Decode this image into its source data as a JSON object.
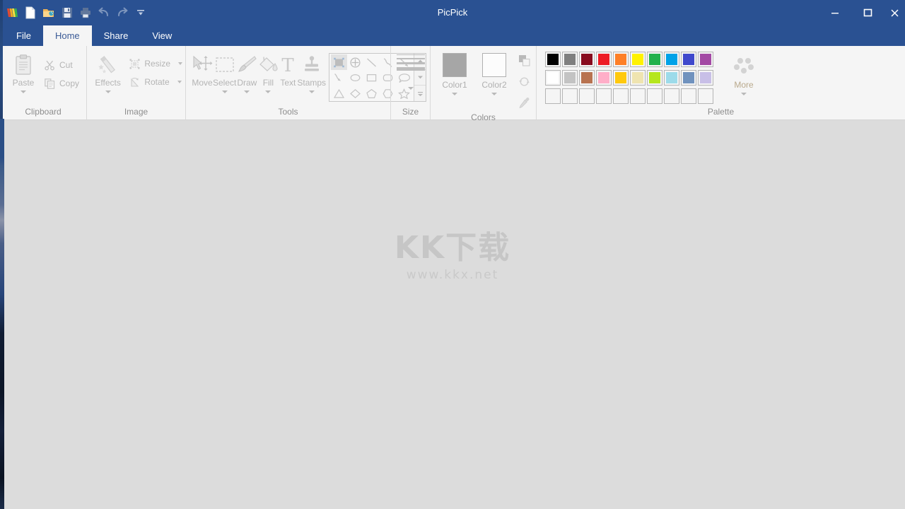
{
  "window": {
    "title": "PicPick",
    "minimize_label": "Minimize",
    "restore_label": "Restore",
    "close_label": "Close"
  },
  "quick_access": {
    "items": [
      {
        "name": "app-logo-icon",
        "label": "PicPick"
      },
      {
        "name": "new-icon",
        "label": "New"
      },
      {
        "name": "open-icon",
        "label": "Open"
      },
      {
        "name": "save-icon",
        "label": "Save"
      },
      {
        "name": "print-icon",
        "label": "Print"
      },
      {
        "name": "undo-icon",
        "label": "Undo"
      },
      {
        "name": "redo-icon",
        "label": "Redo"
      },
      {
        "name": "customize-icon",
        "label": "Customize Quick Access Toolbar"
      }
    ]
  },
  "tabs": [
    {
      "label": "File",
      "active": false
    },
    {
      "label": "Home",
      "active": true
    },
    {
      "label": "Share",
      "active": false
    },
    {
      "label": "View",
      "active": false
    }
  ],
  "ribbon": {
    "clipboard": {
      "label": "Clipboard",
      "paste": "Paste",
      "cut": "Cut",
      "copy": "Copy"
    },
    "image": {
      "label": "Image",
      "effects": "Effects",
      "resize": "Resize",
      "rotate": "Rotate"
    },
    "tools": {
      "label": "Tools",
      "buttons": [
        {
          "label": "Move",
          "has_caret": false
        },
        {
          "label": "Select",
          "has_caret": true
        },
        {
          "label": "Draw",
          "has_caret": true
        },
        {
          "label": "Fill",
          "has_caret": true
        },
        {
          "label": "Text",
          "has_caret": false
        },
        {
          "label": "Stamps",
          "has_caret": true
        }
      ],
      "shapes": [
        {
          "name": "shape-rectangle-filled",
          "selected": true
        },
        {
          "name": "shape-target-circle",
          "selected": false
        },
        {
          "name": "shape-line",
          "selected": false
        },
        {
          "name": "shape-curve",
          "selected": false
        },
        {
          "name": "shape-arrow",
          "selected": false
        },
        {
          "name": "shape-curved-arrow",
          "selected": false
        },
        {
          "name": "shape-ellipse",
          "selected": false
        },
        {
          "name": "shape-rectangle",
          "selected": false
        },
        {
          "name": "shape-rounded-rectangle",
          "selected": false
        },
        {
          "name": "shape-speech-balloon",
          "selected": false
        },
        {
          "name": "shape-triangle",
          "selected": false
        },
        {
          "name": "shape-diamond",
          "selected": false
        },
        {
          "name": "shape-pentagon",
          "selected": false
        },
        {
          "name": "shape-hexagon",
          "selected": false
        },
        {
          "name": "shape-star",
          "selected": false
        }
      ],
      "gallery_scroll": [
        {
          "name": "gallery-scroll-up",
          "label": "Scroll up"
        },
        {
          "name": "gallery-scroll-down",
          "label": "Scroll down"
        },
        {
          "name": "gallery-expand",
          "label": "More shapes"
        }
      ]
    },
    "size": {
      "label": "Size",
      "line_widths": [
        1,
        2,
        3,
        5
      ]
    },
    "colors": {
      "label": "Colors",
      "color1_label": "Color1",
      "color1_value": "#a6a6a6",
      "color2_label": "Color2",
      "color2_value": "#fcfcfc",
      "tools": [
        {
          "name": "color-swap-icon",
          "label": "Swap colors"
        },
        {
          "name": "color-reset-icon",
          "label": "Reset colors"
        },
        {
          "name": "color-picker-icon",
          "label": "Color picker"
        }
      ]
    },
    "palette": {
      "label": "Palette",
      "more_label": "More",
      "rows": [
        [
          "#000000",
          "#7f7f7f",
          "#880b1e",
          "#ed1c25",
          "#fe7f27",
          "#fff200",
          "#22b14c",
          "#00a2e8",
          "#3f48cc",
          "#a349a4"
        ],
        [
          "#ffffff",
          "#c3c3c3",
          "#b87350",
          "#ffaec8",
          "#ffc90d",
          "#efe4b0",
          "#b5e61d",
          "#9ddbea",
          "#7092be",
          "#c8bfe7"
        ],
        [
          "",
          "",
          "",
          "",
          "",
          "",
          "",
          "",
          "",
          ""
        ]
      ]
    }
  },
  "canvas": {
    "watermark_main": "KK下载",
    "watermark_sub": "www.kkx.net",
    "background_color": "#dcdcdc"
  }
}
